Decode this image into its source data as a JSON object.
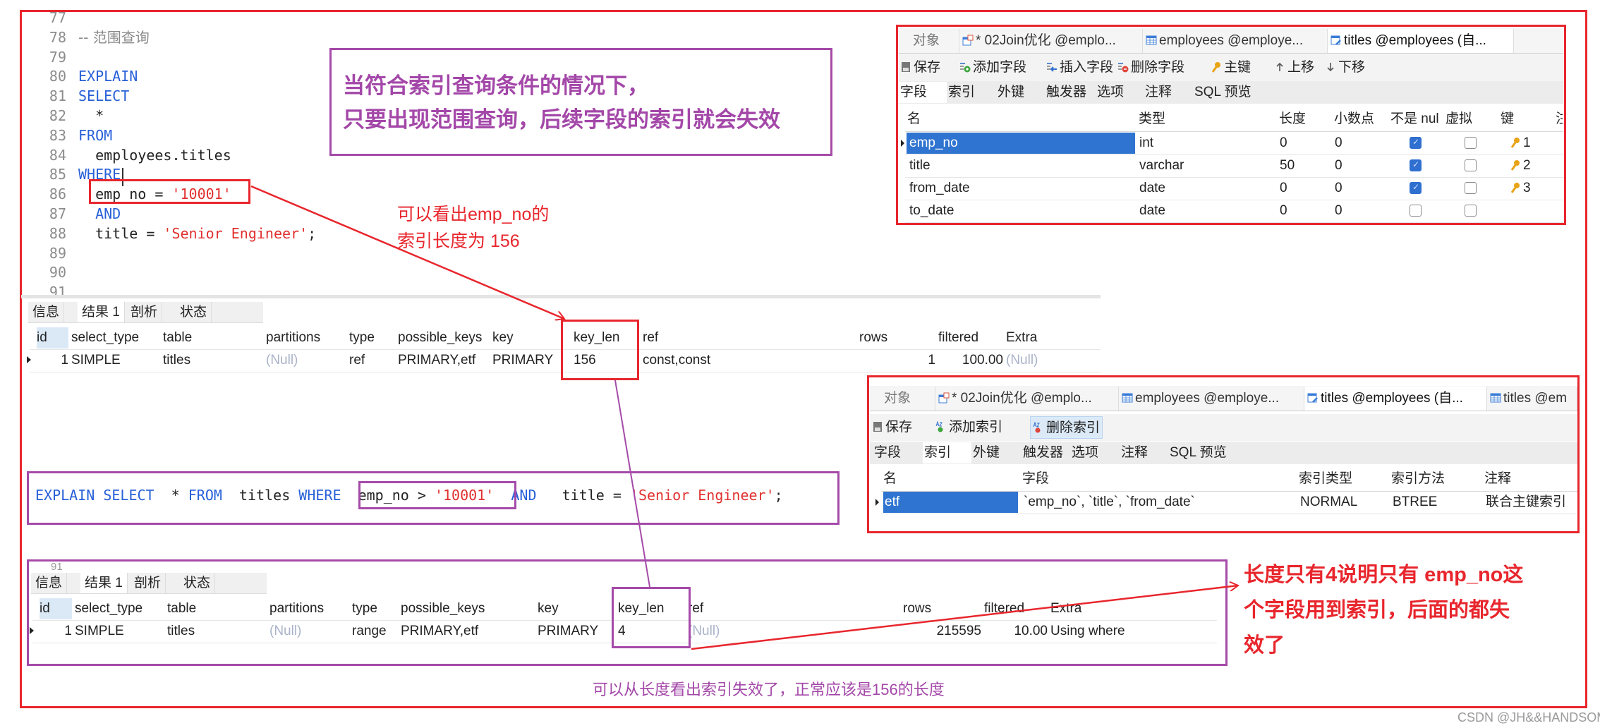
{
  "editor": {
    "lines": [
      {
        "n": "77",
        "tokens": []
      },
      {
        "n": "78",
        "tokens": [
          {
            "t": "-- 范围查询",
            "c": "cm"
          }
        ]
      },
      {
        "n": "79",
        "tokens": []
      },
      {
        "n": "80",
        "tokens": [
          {
            "t": "EXPLAIN",
            "c": "kw"
          }
        ]
      },
      {
        "n": "81",
        "tokens": [
          {
            "t": "SELECT",
            "c": "kw"
          }
        ]
      },
      {
        "n": "82",
        "tokens": [
          {
            "t": "  *",
            "c": "plain"
          }
        ]
      },
      {
        "n": "83",
        "tokens": [
          {
            "t": "FROM",
            "c": "kw"
          }
        ]
      },
      {
        "n": "84",
        "tokens": [
          {
            "t": "  employees.titles",
            "c": "plain"
          }
        ]
      },
      {
        "n": "85",
        "tokens": [
          {
            "t": "WHERE",
            "c": "kw"
          }
        ]
      },
      {
        "n": "86",
        "tokens": [
          {
            "t": "  emp_no = ",
            "c": "plain"
          },
          {
            "t": "'10001'",
            "c": "str"
          }
        ]
      },
      {
        "n": "87",
        "tokens": [
          {
            "t": "  AND",
            "c": "kw"
          }
        ]
      },
      {
        "n": "88",
        "tokens": [
          {
            "t": "  title = ",
            "c": "plain"
          },
          {
            "t": "'Senior Engineer'",
            "c": "str"
          },
          {
            "t": ";",
            "c": "plain"
          }
        ]
      },
      {
        "n": "89",
        "tokens": []
      },
      {
        "n": "90",
        "tokens": []
      },
      {
        "n": "91",
        "tokens": []
      }
    ]
  },
  "result1": {
    "tabs": [
      "信息",
      "结果 1",
      "剖析",
      "状态"
    ],
    "active_tab": 1,
    "columns": [
      "id",
      "select_type",
      "table",
      "partitions",
      "type",
      "possible_keys",
      "key",
      "key_len",
      "ref",
      "rows",
      "filtered",
      "Extra"
    ],
    "rows": [
      [
        "1",
        "SIMPLE",
        "titles",
        "(Null)",
        "ref",
        "PRIMARY,etf",
        "PRIMARY",
        "156",
        "const,const",
        "1",
        "100.00",
        "(Null)"
      ]
    ]
  },
  "query_line": {
    "tokens": [
      {
        "t": "EXPLAIN SELECT ",
        "c": "kw"
      },
      {
        "t": " * ",
        "c": "plain"
      },
      {
        "t": "FROM ",
        "c": "kw"
      },
      {
        "t": " titles ",
        "c": "plain"
      },
      {
        "t": "WHERE ",
        "c": "kw"
      },
      {
        "t": " emp_no > ",
        "c": "plain"
      },
      {
        "t": "'10001'",
        "c": "str"
      },
      {
        "t": "  ",
        "c": "plain"
      },
      {
        "t": "AND",
        "c": "kw"
      },
      {
        "t": "   title = ",
        "c": "plain"
      },
      {
        "t": "'Senior Engineer'",
        "c": "str"
      },
      {
        "t": ";",
        "c": "plain"
      }
    ]
  },
  "result2": {
    "line_number": "91",
    "tabs": [
      "信息",
      "结果 1",
      "剖析",
      "状态"
    ],
    "active_tab": 1,
    "columns": [
      "id",
      "select_type",
      "table",
      "partitions",
      "type",
      "possible_keys",
      "key",
      "key_len",
      "ref",
      "rows",
      "filtered",
      "Extra"
    ],
    "rows": [
      [
        "1",
        "SIMPLE",
        "titles",
        "(Null)",
        "range",
        "PRIMARY,etf",
        "PRIMARY",
        "4",
        "(Null)",
        "215595",
        "10.00",
        "Using where"
      ]
    ]
  },
  "callout_top": {
    "lines": [
      "当符合索引查询条件的情况下，",
      "只要出现范围查询，后续字段的索引就会失效"
    ]
  },
  "note_key_len": {
    "lines": [
      "可以看出emp_no的",
      "索引长度为 156"
    ]
  },
  "note_right": {
    "lines": [
      "长度只有4说明只有 emp_no这",
      "个字段用到索引，后面的都失",
      "效了"
    ]
  },
  "note_bottom": "可以从长度看出索引失效了，正常应该是156的长度",
  "watermark": "CSDN @JH&&HANDSOME",
  "design_panel": {
    "tabs": [
      {
        "label": "对象",
        "icon": "none"
      },
      {
        "label": "* 02Join优化 @emplo...",
        "icon": "query-table-icon"
      },
      {
        "label": "employees @employe...",
        "icon": "table-icon"
      },
      {
        "label": "titles @employees (自...",
        "icon": "table-edit-icon",
        "active": true
      }
    ],
    "toolbar": [
      {
        "label": "保存",
        "icon": "save-icon"
      },
      {
        "label": "添加字段",
        "icon": "add-field-icon"
      },
      {
        "label": "插入字段",
        "icon": "insert-field-icon"
      },
      {
        "label": "删除字段",
        "icon": "delete-field-icon"
      },
      {
        "label": "主键",
        "icon": "key-icon"
      },
      {
        "label": "上移",
        "icon": "arrow-up-icon"
      },
      {
        "label": "下移",
        "icon": "arrow-down-icon"
      }
    ],
    "subtabs": [
      "字段",
      "索引",
      "外键",
      "触发器",
      "选项",
      "注释",
      "SQL 预览"
    ],
    "active_subtab": 0,
    "columns": [
      "名",
      "类型",
      "长度",
      "小数点",
      "不是 nul",
      "虚拟",
      "键",
      "注"
    ],
    "rows": [
      {
        "name": "emp_no",
        "type": "int",
        "length": "0",
        "decimals": "0",
        "not_null": true,
        "virtual": false,
        "key": "1",
        "selected": true
      },
      {
        "name": "title",
        "type": "varchar",
        "length": "50",
        "decimals": "0",
        "not_null": true,
        "virtual": false,
        "key": "2"
      },
      {
        "name": "from_date",
        "type": "date",
        "length": "0",
        "decimals": "0",
        "not_null": true,
        "virtual": false,
        "key": "3"
      },
      {
        "name": "to_date",
        "type": "date",
        "length": "0",
        "decimals": "0",
        "not_null": false,
        "virtual": false,
        "key": ""
      }
    ]
  },
  "index_panel": {
    "tabs": [
      {
        "label": "对象",
        "icon": "none"
      },
      {
        "label": "* 02Join优化 @emplo...",
        "icon": "query-table-icon"
      },
      {
        "label": "employees @employe...",
        "icon": "table-icon"
      },
      {
        "label": "titles @employees (自...",
        "icon": "table-edit-icon",
        "active": true
      },
      {
        "label": "titles @em",
        "icon": "table-icon"
      }
    ],
    "toolbar": [
      {
        "label": "保存",
        "icon": "save-icon"
      },
      {
        "label": "添加索引",
        "icon": "add-index-icon"
      },
      {
        "label": "删除索引",
        "icon": "delete-index-icon"
      }
    ],
    "subtabs": [
      "字段",
      "索引",
      "外键",
      "触发器",
      "选项",
      "注释",
      "SQL 预览"
    ],
    "active_subtab": 1,
    "columns": [
      "名",
      "字段",
      "索引类型",
      "索引方法",
      "注释"
    ],
    "rows": [
      [
        "etf",
        "`emp_no`, `title`, `from_date`",
        "NORMAL",
        "BTREE",
        "联合主键索引"
      ]
    ]
  },
  "colors": {
    "annotation_red": "#e8262d",
    "annotation_purple": "#a54aa8",
    "keyword": "#2760d8",
    "string": "#e0302e",
    "selection": "#2f74d0"
  }
}
